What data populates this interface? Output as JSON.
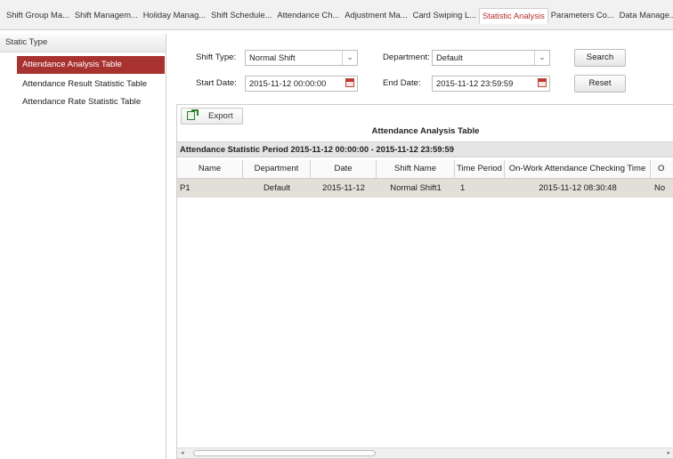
{
  "tabs": [
    {
      "label": "Shift Group Ma..."
    },
    {
      "label": "Shift Managem..."
    },
    {
      "label": "Holiday Manag..."
    },
    {
      "label": "Shift Schedule..."
    },
    {
      "label": "Attendance Ch..."
    },
    {
      "label": "Adjustment Ma..."
    },
    {
      "label": "Card Swiping L..."
    },
    {
      "label": "Statistic Analysis"
    },
    {
      "label": "Parameters Co..."
    },
    {
      "label": "Data Manage..."
    }
  ],
  "sidebar": {
    "header": "Static Type",
    "items": [
      {
        "label": "Attendance Analysis Table"
      },
      {
        "label": "Attendance Result Statistic Table"
      },
      {
        "label": "Attendance Rate Statistic Table"
      }
    ]
  },
  "filters": {
    "shift_type_label": "Shift Type:",
    "shift_type_value": "Normal Shift",
    "department_label": "Department:",
    "department_value": "Default",
    "start_date_label": "Start Date:",
    "start_date_value": "2015-11-12 00:00:00",
    "end_date_label": "End Date:",
    "end_date_value": "2015-11-12 23:59:59",
    "search_label": "Search",
    "reset_label": "Reset"
  },
  "toolbar": {
    "export_label": "Export"
  },
  "table": {
    "title": "Attendance Analysis Table",
    "period": "Attendance Statistic Period 2015-11-12 00:00:00 - 2015-11-12 23:59:59",
    "columns": [
      "Name",
      "Department",
      "Date",
      "Shift Name",
      "Time Period",
      "On-Work Attendance Checking Time",
      "O"
    ],
    "rows": [
      [
        "P1",
        "Default",
        "2015-11-12",
        "Normal Shift1",
        "1",
        "2015-11-12 08:30:48",
        "No"
      ]
    ]
  },
  "colors": {
    "accent": "#a8322f",
    "active_tab_text": "#b52b2b",
    "selected_row": "#e2ded8"
  }
}
